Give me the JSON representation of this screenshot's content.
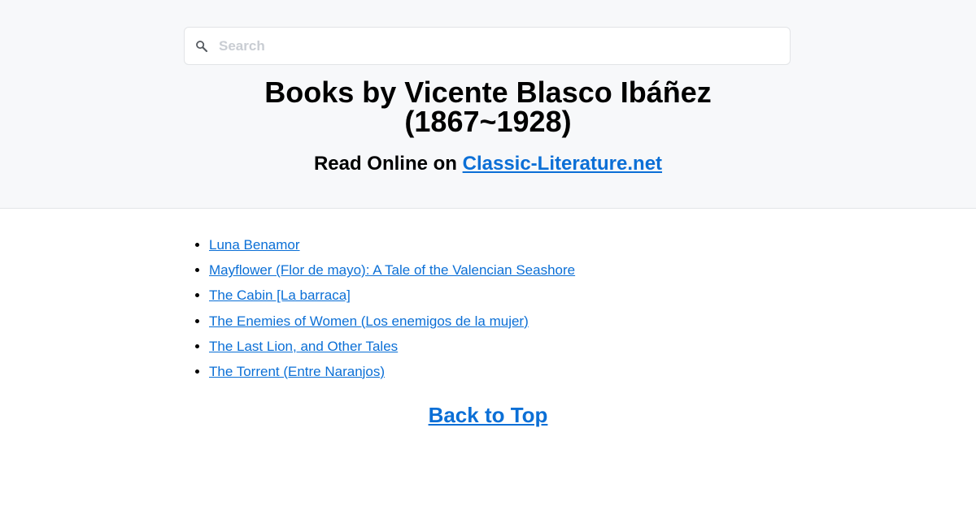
{
  "search": {
    "placeholder": "Search",
    "value": ""
  },
  "header": {
    "title_line1": "Books by Vicente Blasco Ibáñez",
    "title_line2": "(1867~1928)",
    "subtitle_prefix": "Read Online on ",
    "site_link": "Classic-Literature.net"
  },
  "books": [
    {
      "title": "Luna Benamor"
    },
    {
      "title": "Mayflower (Flor de mayo): A Tale of the Valencian Seashore"
    },
    {
      "title": "The Cabin [La barraca]"
    },
    {
      "title": "The Enemies of Women (Los enemigos de la mujer)"
    },
    {
      "title": "The Last Lion, and Other Tales"
    },
    {
      "title": "The Torrent (Entre Naranjos)"
    }
  ],
  "footer": {
    "back_to_top": "Back to Top"
  },
  "colors": {
    "link": "#0b6fd6",
    "header_bg": "#f7f8fa",
    "placeholder": "#c9cdd3"
  },
  "icons": {
    "search": "search-icon"
  }
}
